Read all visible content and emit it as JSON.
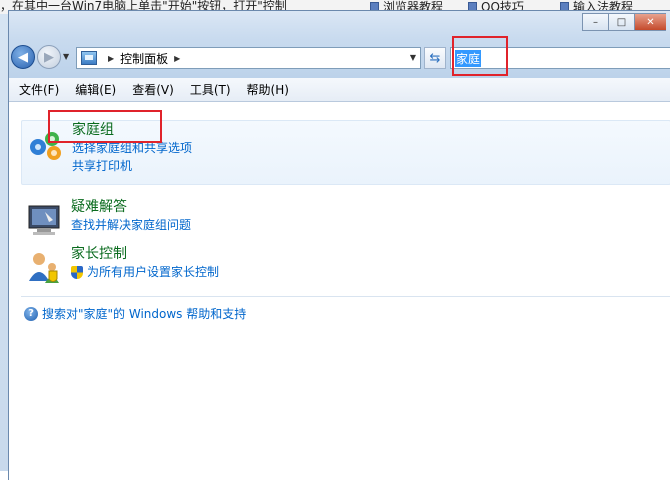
{
  "background": {
    "instruction_text": "，在其中一台Win7电脑上单击\"开始\"按钮，打开\"控制",
    "links": [
      "浏览器教程",
      "QQ技巧",
      "输入法教程"
    ]
  },
  "window": {
    "caption": {
      "minimize": "–",
      "maximize": "□",
      "close": "✕"
    },
    "address": {
      "crumb": "控制面板"
    },
    "search": {
      "value": "家庭"
    }
  },
  "menu": [
    "文件(F)",
    "编辑(E)",
    "查看(V)",
    "工具(T)",
    "帮助(H)"
  ],
  "results": [
    {
      "title": "家庭组",
      "links": [
        "选择家庭组和共享选项",
        "共享打印机"
      ],
      "icon": "homegroup-icon"
    },
    {
      "title": "疑难解答",
      "links": [
        "查找并解决家庭组问题"
      ],
      "icon": "troubleshooting-icon"
    },
    {
      "title": "家长控制",
      "links": [
        "为所有用户设置家长控制"
      ],
      "icon": "parental-controls-icon",
      "link_icon": "shield-icon"
    }
  ],
  "help_link": "搜索对\"家庭\"的 Windows 帮助和支持",
  "colors": {
    "title_green": "#0a6b1e",
    "link_blue": "#0066cc",
    "annotation_red": "#e0232b",
    "selection": "#3399ff"
  }
}
